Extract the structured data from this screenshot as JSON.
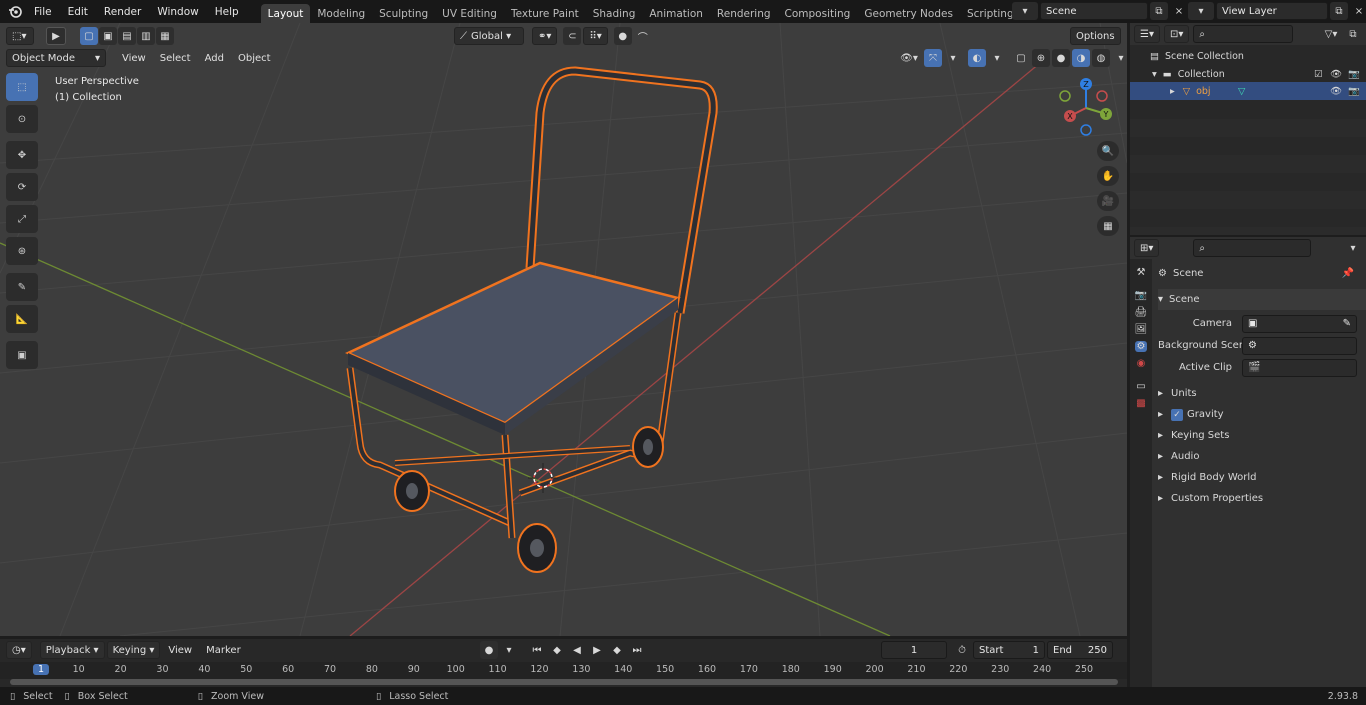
{
  "menu": [
    "File",
    "Edit",
    "Render",
    "Window",
    "Help"
  ],
  "workspaces": [
    "Layout",
    "Modeling",
    "Sculpting",
    "UV Editing",
    "Texture Paint",
    "Shading",
    "Animation",
    "Rendering",
    "Compositing",
    "Geometry Nodes",
    "Scripting"
  ],
  "active_workspace": "Layout",
  "scene_field": "Scene",
  "view_layer_field": "View Layer",
  "viewport": {
    "mode": "Object Mode",
    "menus": [
      "View",
      "Select",
      "Add",
      "Object"
    ],
    "transform_orientation": "Global",
    "options": "Options",
    "overlay_title": "User Perspective",
    "overlay_collection": "(1) Collection",
    "gizmo_axes": {
      "x": "X",
      "y": "Y",
      "z": "Z"
    }
  },
  "outliner": {
    "scene_collection": "Scene Collection",
    "collection": "Collection",
    "object": "obj"
  },
  "properties": {
    "context": "Scene",
    "panel": "Scene",
    "camera_label": "Camera",
    "background_scene_label": "Background Scene",
    "active_clip_label": "Active Clip",
    "sections": [
      "Units",
      "Gravity",
      "Keying Sets",
      "Audio",
      "Rigid Body World",
      "Custom Properties"
    ]
  },
  "timeline": {
    "menus": [
      "Playback",
      "Keying",
      "View",
      "Marker"
    ],
    "current_frame": "1",
    "start_label": "Start",
    "start_value": "1",
    "end_label": "End",
    "end_value": "250",
    "ticks": [
      "1",
      "10",
      "20",
      "30",
      "40",
      "50",
      "60",
      "70",
      "80",
      "90",
      "100",
      "110",
      "120",
      "130",
      "140",
      "150",
      "160",
      "170",
      "180",
      "190",
      "200",
      "210",
      "220",
      "230",
      "240",
      "250"
    ]
  },
  "status": {
    "select": "Select",
    "box_select": "Box Select",
    "zoom_view": "Zoom View",
    "lasso_select": "Lasso Select",
    "version": "2.93.8"
  },
  "colors": {
    "accent": "#4772b3",
    "selection": "#f0731f",
    "x_axis": "#c64d4d",
    "y_axis": "#7ea53a",
    "z_axis": "#2f7fe3"
  }
}
